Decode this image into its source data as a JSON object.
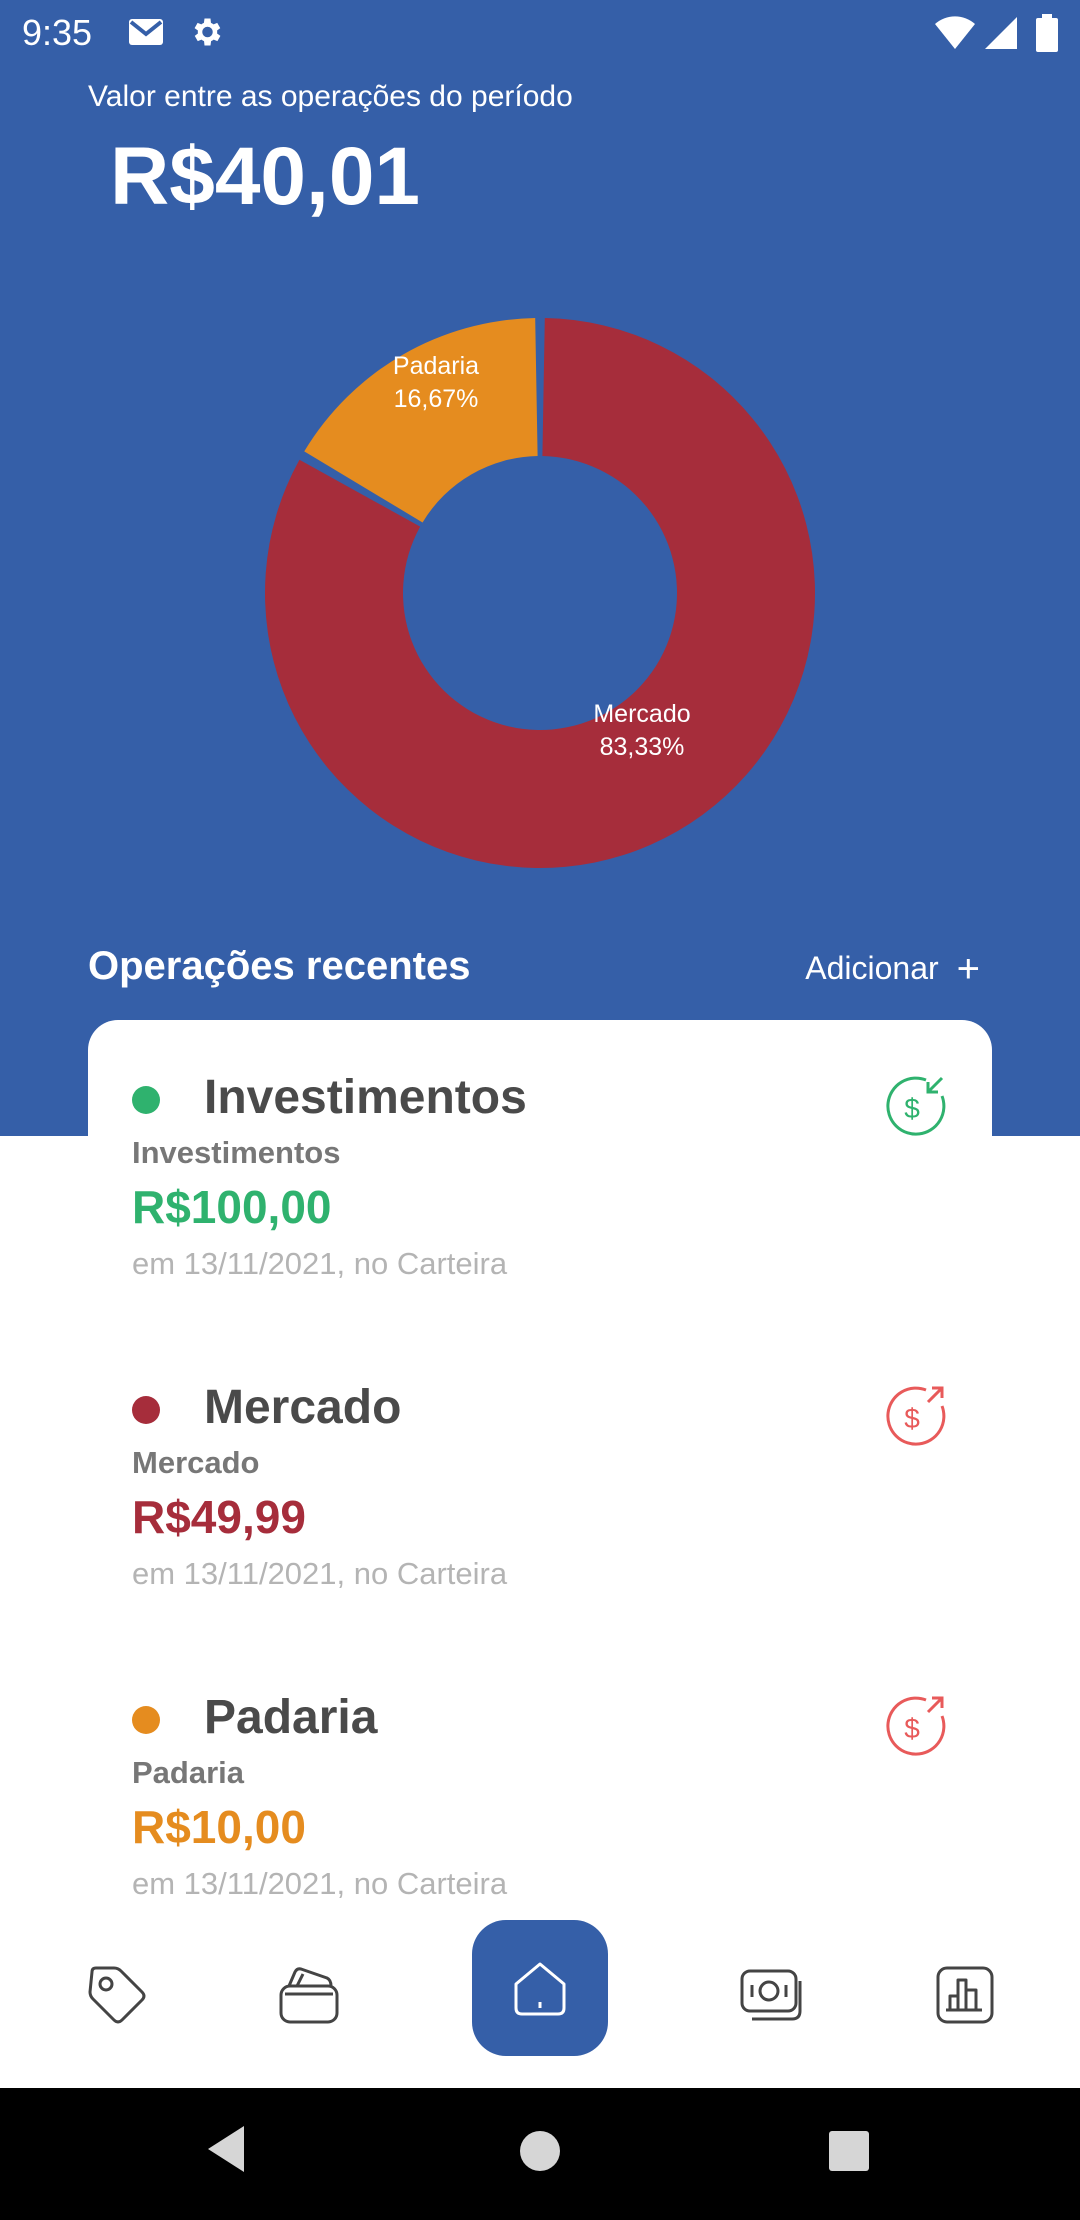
{
  "status_bar": {
    "time": "9:35"
  },
  "summary": {
    "label": "Valor entre as operações do período",
    "value": "R$40,01"
  },
  "chart_data": {
    "type": "pie",
    "categories": [
      "Mercado",
      "Padaria"
    ],
    "values": [
      83.33,
      16.67
    ],
    "labels": [
      "83,33%",
      "16,67%"
    ],
    "colors": [
      "#A62D3B",
      "#E58C1F"
    ]
  },
  "recent": {
    "title": "Operações recentes",
    "add_label": "Adicionar",
    "items": [
      {
        "title": "Investimentos",
        "subtitle": "Investimentos",
        "value": "R$100,00",
        "date": "em 13/11/2021, no Carteira",
        "color": "#2FB26E",
        "icon": "income-icon"
      },
      {
        "title": "Mercado",
        "subtitle": "Mercado",
        "value": "R$49,99",
        "date": "em 13/11/2021, no Carteira",
        "color": "#A62D3B",
        "icon": "expense-icon"
      },
      {
        "title": "Padaria",
        "subtitle": "Padaria",
        "value": "R$10,00",
        "date": "em 13/11/2021, no Carteira",
        "color": "#E58C1F",
        "icon": "expense-icon"
      }
    ]
  },
  "nav": {
    "items": [
      "tag-icon",
      "wallet-icon",
      "home-icon",
      "money-icon",
      "chart-icon"
    ],
    "active": "home-icon",
    "accent": "#355FA8"
  },
  "colors": {
    "primary": "#355FA8",
    "income": "#2FB26E",
    "expense_icon": "#E85A5A"
  }
}
